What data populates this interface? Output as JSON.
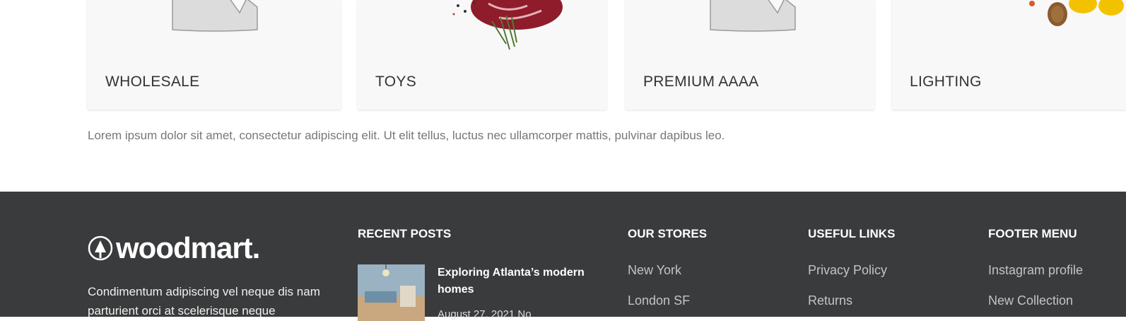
{
  "categories": [
    {
      "title": "WHOLESALE",
      "image": "placeholder-image-icon"
    },
    {
      "title": "TOYS",
      "image": "steak-photo"
    },
    {
      "title": "PREMIUM AAAA",
      "image": "placeholder-image-icon"
    },
    {
      "title": "LIGHTING",
      "image": "vegetables-photo"
    }
  ],
  "description": "Lorem ipsum dolor sit amet, consectetur adipiscing elit. Ut elit tellus, luctus nec ullamcorper mattis, pulvinar dapibus leo.",
  "footer": {
    "logo_text": "woodmart.",
    "logo_icon": "tree-circle-icon",
    "about": "Condimentum adipiscing vel neque dis nam parturient orci at scelerisque neque",
    "recent_posts": {
      "heading": "RECENT POSTS",
      "items": [
        {
          "title": "Exploring Atlanta’s modern homes",
          "meta": "August 27, 2021  No"
        }
      ]
    },
    "our_stores": {
      "heading": "OUR STORES",
      "links": [
        "New York",
        "London SF"
      ]
    },
    "useful_links": {
      "heading": "USEFUL LINKS",
      "links": [
        "Privacy Policy",
        "Returns"
      ]
    },
    "footer_menu": {
      "heading": "FOOTER MENU",
      "links": [
        "Instagram profile",
        "New Collection"
      ]
    }
  },
  "colors": {
    "footer_bg": "#3a3b3c",
    "muted_link": "#c3c3c3",
    "card_bg": "#f8f8f8"
  }
}
